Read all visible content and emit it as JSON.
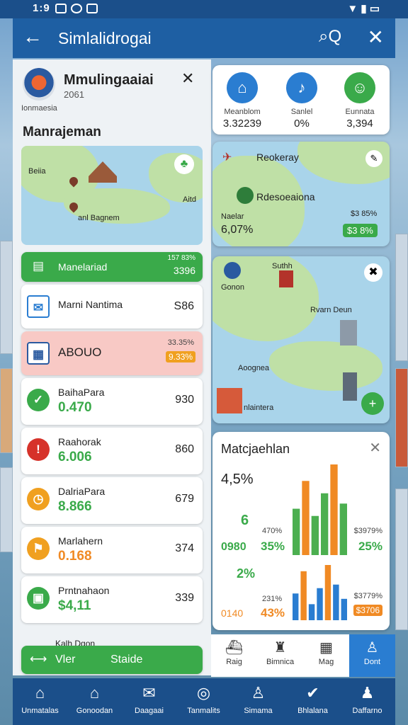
{
  "status": {
    "time": "1:9"
  },
  "topbar": {
    "title": "Simlalidrogai"
  },
  "header": {
    "title": "Mmulingaaiai",
    "subtitle": "2061",
    "country": "Ionmaesia"
  },
  "section_title": "Manrajeman",
  "map1": {
    "labels": [
      "Beiia",
      "anl Bagnem",
      "Aitd"
    ]
  },
  "list": [
    {
      "name": "Manelariad",
      "num": "3396",
      "badge": "157 83%",
      "style": "green"
    },
    {
      "name": "Marni Nantima",
      "num": "S86",
      "style": "plain"
    },
    {
      "name": "ABOUO",
      "num": "9.33%",
      "badge": "33.35%",
      "style": "pink"
    },
    {
      "name": "BaihaPara",
      "value": "0.470",
      "num": "930",
      "icon_color": "#3aaa4a"
    },
    {
      "name": "Raahorak",
      "value": "6.006",
      "num": "860",
      "icon_color": "#d6322a"
    },
    {
      "name": "DalriaPara",
      "value": "8.866",
      "num": "679",
      "icon_color": "#f0a020"
    },
    {
      "name": "Marlahern",
      "value": "0.168",
      "num": "374",
      "icon_color": "#f0a020"
    },
    {
      "name": "Prntnahaon",
      "value": "$4,11",
      "num": "339",
      "icon_color": "#3aaa4a"
    }
  ],
  "footer_green": {
    "left": "Vler",
    "right": "Staide",
    "peek": "Kalh Dgon"
  },
  "stats": [
    {
      "label": "Meanblom",
      "value": "3.32239",
      "color": "#2a7dd1"
    },
    {
      "label": "Sanlel",
      "value": "0%",
      "color": "#2a7dd1"
    },
    {
      "label": "Eunnata",
      "value": "3,394",
      "color": "#3aaa4a"
    }
  ],
  "map2": {
    "title": "Reokeray",
    "label2": "Rdesoeaiona",
    "left_label": "Naelar",
    "left_value": "6,07%",
    "right_label": "$3 85%",
    "right_value": "$3 8%"
  },
  "map3": {
    "labels": [
      "Gonon",
      "Suthh",
      "Rvarn Deun",
      "Aoognea",
      "nlaintera"
    ]
  },
  "chart": {
    "title": "Matcjaehlan",
    "big": "4,5%",
    "left_vals": [
      "6",
      "0980",
      "2%",
      "0140"
    ],
    "mid_vals": [
      "470%",
      "35%",
      "231%",
      "43%"
    ],
    "right_vals": [
      "$3979%",
      "25%",
      "$3779%",
      "$3706"
    ]
  },
  "chart_data": [
    {
      "type": "bar",
      "series": [
        {
          "values": [
            45,
            72,
            38,
            60,
            88,
            50
          ]
        }
      ],
      "colors": [
        "#4caf50",
        "#f08a24"
      ]
    },
    {
      "type": "bar",
      "series": [
        {
          "values": [
            30,
            55,
            18,
            36,
            62,
            40,
            24
          ]
        }
      ],
      "colors": [
        "#2a7dd1",
        "#f08a24"
      ]
    }
  ],
  "tabs": [
    "Raig",
    "Bimnica",
    "Mag",
    "Dont"
  ],
  "nav": [
    "Unmatalas",
    "Gonoodan",
    "Daagaai",
    "Tanmalits",
    "Simama",
    "Bhlalana",
    "Daffarno"
  ]
}
